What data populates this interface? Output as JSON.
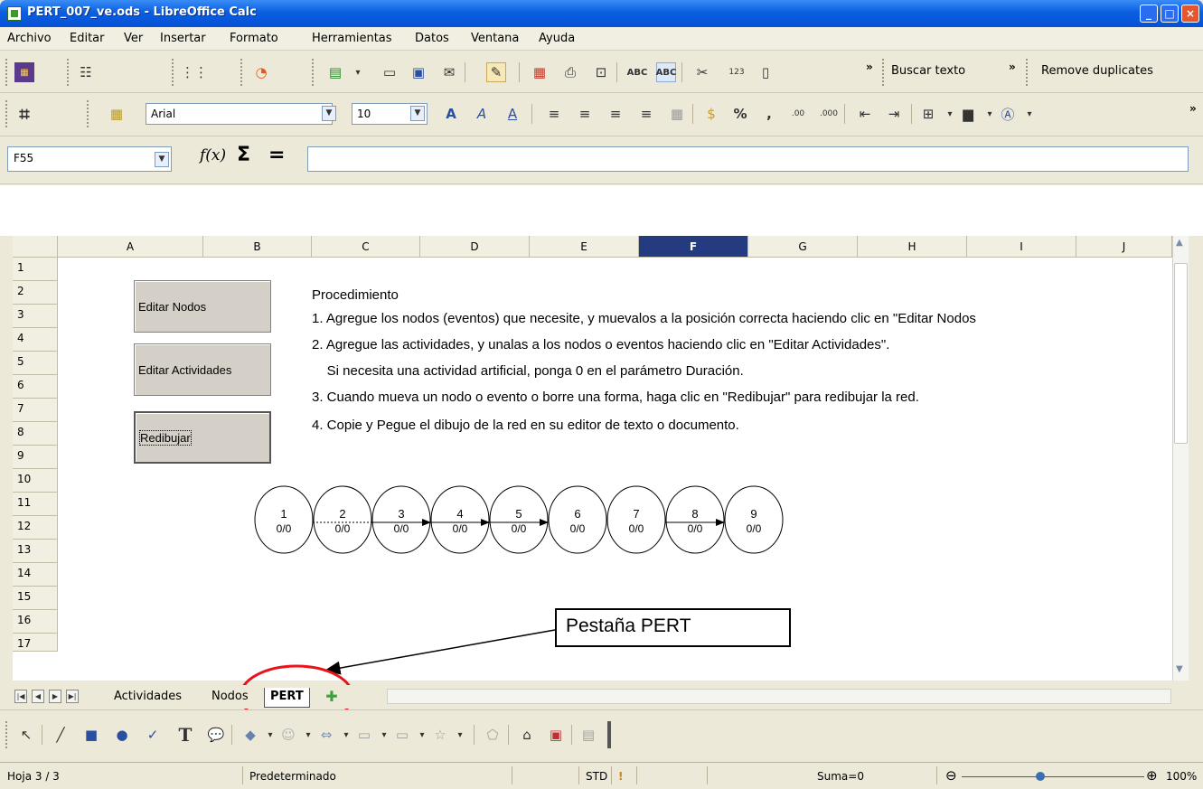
{
  "window": {
    "title": "PERT_007_ve.ods - LibreOffice Calc"
  },
  "menu": [
    "Archivo",
    "Editar",
    "Ver",
    "Insertar",
    "Formato",
    "Herramientas",
    "Datos",
    "Ventana",
    "Ayuda"
  ],
  "toolbar": {
    "find_label": "Buscar texto",
    "remove_dup_label": "Remove duplicates",
    "font_name": "Arial",
    "font_size": "10"
  },
  "formula_bar": {
    "cell_ref": "F55",
    "fx": "f(x)",
    "sigma": "Σ",
    "equals": "=",
    "content": ""
  },
  "grid": {
    "columns": [
      "A",
      "B",
      "C",
      "D",
      "E",
      "F",
      "G",
      "H",
      "I",
      "J"
    ],
    "active_column": "F",
    "rows": [
      "1",
      "2",
      "3",
      "4",
      "5",
      "6",
      "7",
      "8",
      "9",
      "10",
      "11",
      "12",
      "13",
      "14",
      "15",
      "16",
      "17"
    ]
  },
  "sheet": {
    "buttons": [
      "Editar Nodos",
      "Editar Actividades",
      "Redibujar"
    ],
    "procedure": {
      "heading": "Procedimiento",
      "steps": [
        "1. Agregue los nodos (eventos) que necesite, y muevalos a la posición correcta haciendo clic en \"Editar Nodos",
        "2. Agregue las actividades, y unalas a los nodos o eventos haciendo clic en  \"Editar Actividades\".",
        "    Si necesita una actividad artificial, ponga 0 en el parámetro Duración.",
        "3. Cuando mueva un nodo o evento o borre una forma, haga clic en \"Redibujar\" para redibujar la red.",
        "4. Copie y Pegue el dibujo de la red en su editor de texto o documento."
      ]
    },
    "nodes": [
      {
        "id": "1",
        "value": "0/0"
      },
      {
        "id": "2",
        "value": "0/0"
      },
      {
        "id": "3",
        "value": "0/0"
      },
      {
        "id": "4",
        "value": "0/0"
      },
      {
        "id": "5",
        "value": "0/0"
      },
      {
        "id": "6",
        "value": "0/0"
      },
      {
        "id": "7",
        "value": "0/0"
      },
      {
        "id": "8",
        "value": "0/0"
      },
      {
        "id": "9",
        "value": "0/0"
      }
    ]
  },
  "tabs": [
    "Actividades",
    "Nodos",
    "PERT"
  ],
  "active_tab": "PERT",
  "callout": "Pestaña PERT",
  "status": {
    "sheet": "Hoja 3 / 3",
    "style": "Predeterminado",
    "mode": "STD",
    "sum": "Suma=0",
    "zoom": "100%"
  },
  "colors": {
    "titlebar": "#0a5fe0",
    "active_column": "#243b80",
    "annotation_circle": "#e8141b"
  },
  "icons": [
    "app-icon",
    "minimize-icon",
    "maximize-icon",
    "close-icon",
    "crop-icon",
    "bold-icon",
    "italic-icon",
    "underline-icon",
    "plus-icon",
    "arrow-icon",
    "rectangle-icon",
    "ellipse-icon",
    "text-icon",
    "star-icon"
  ]
}
